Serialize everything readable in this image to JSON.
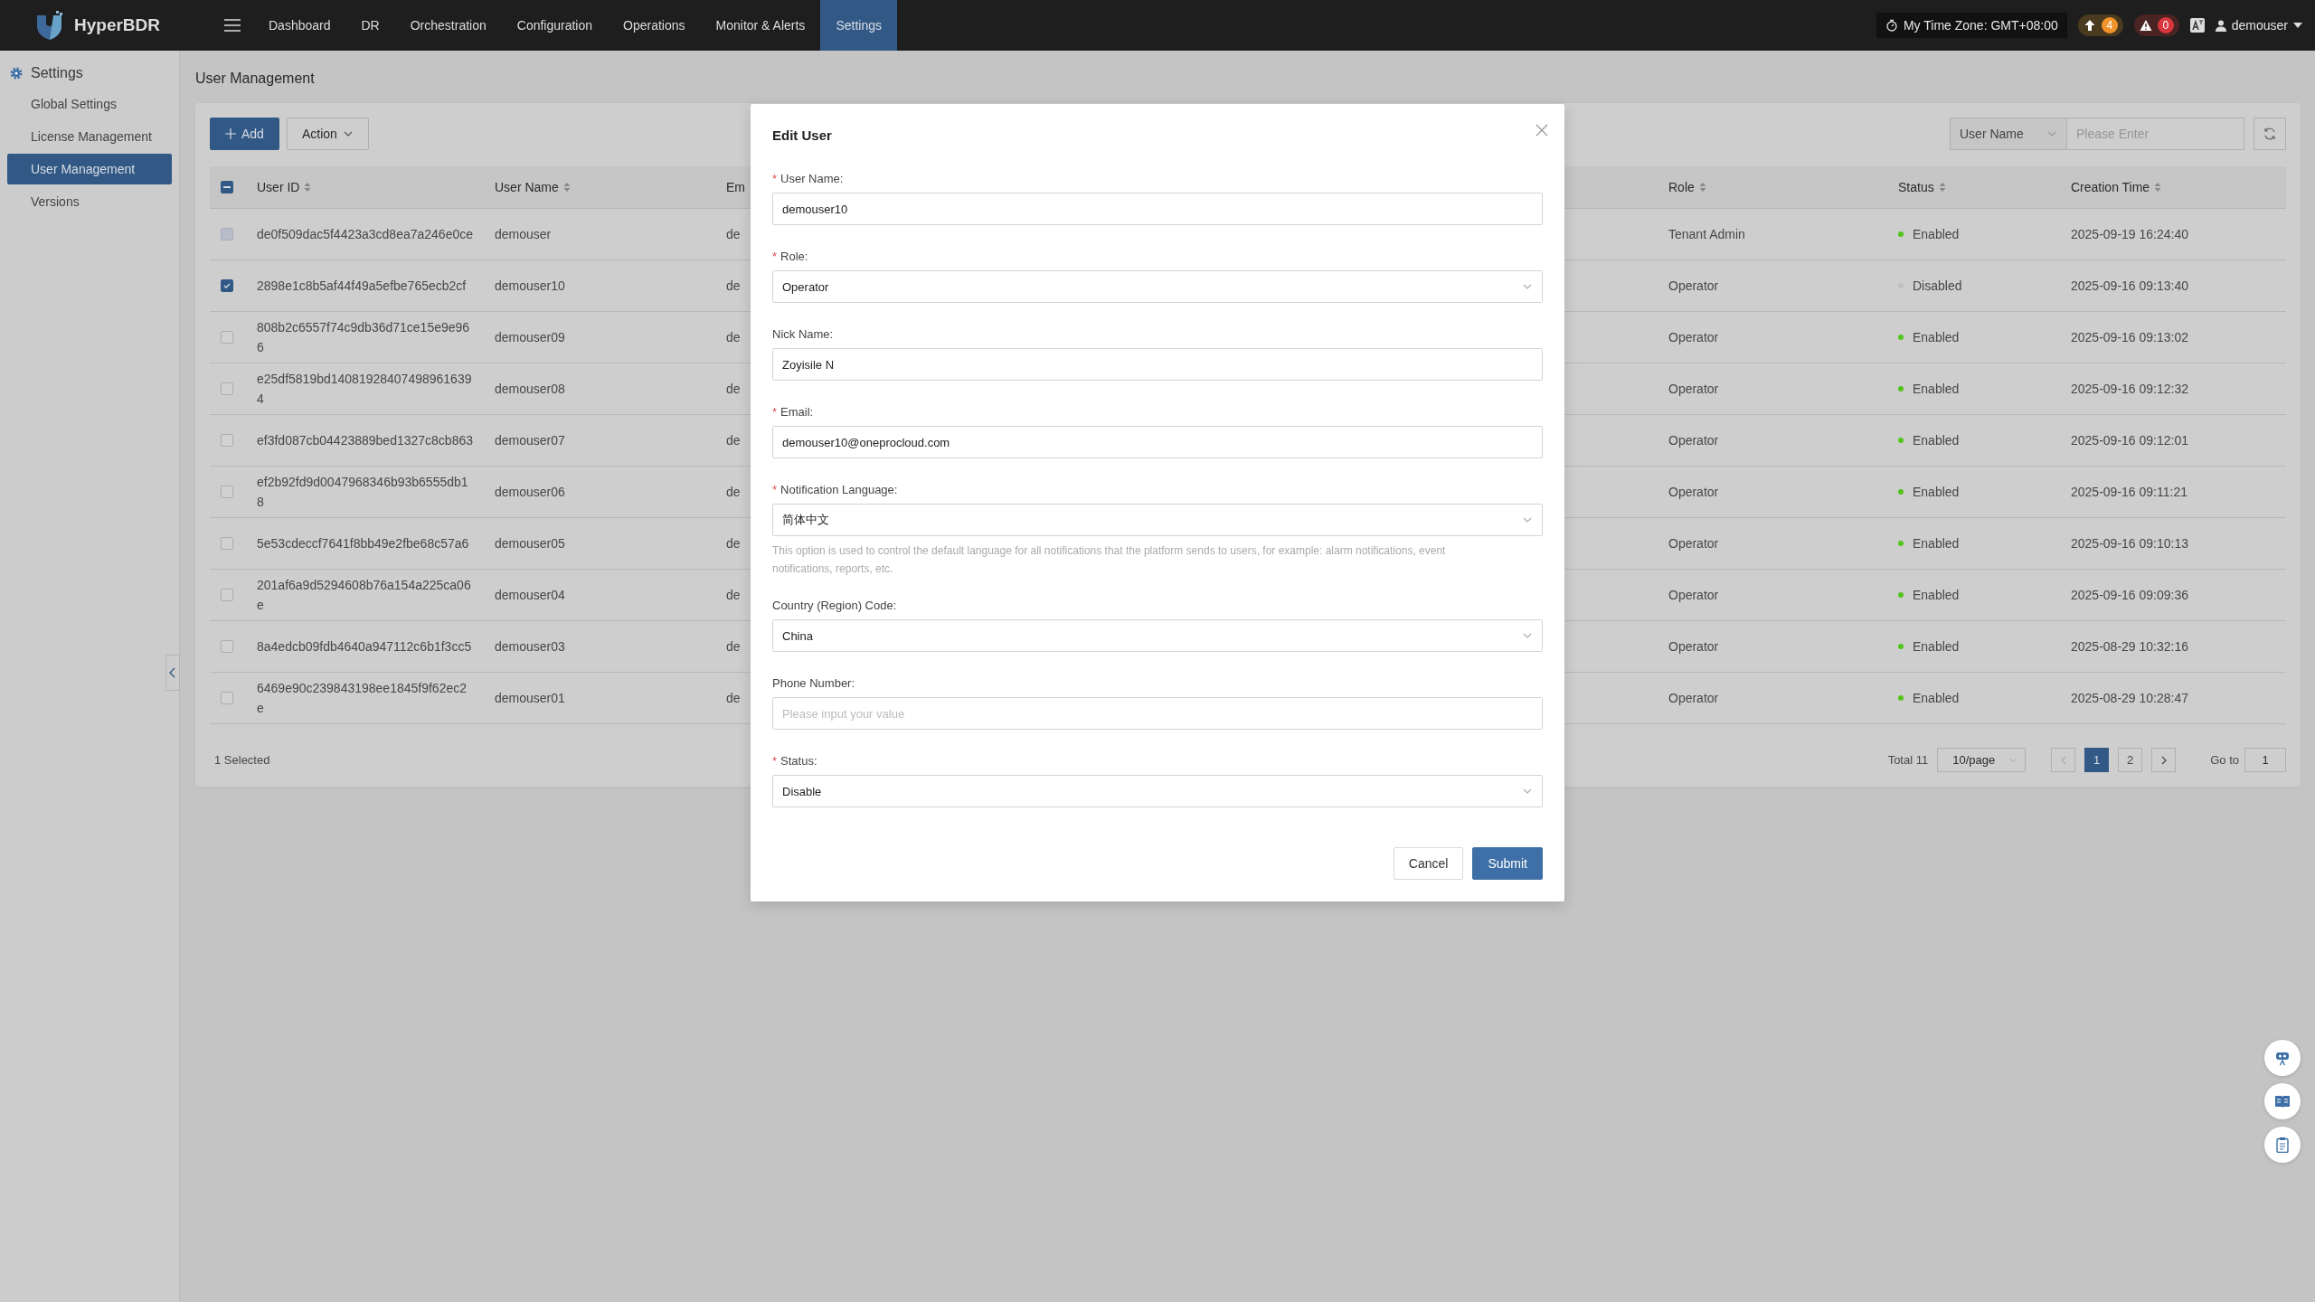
{
  "brand": "HyperBDR",
  "nav": [
    {
      "label": "Dashboard",
      "selected": false
    },
    {
      "label": "DR",
      "selected": false
    },
    {
      "label": "Orchestration",
      "selected": false
    },
    {
      "label": "Configuration",
      "selected": false
    },
    {
      "label": "Operations",
      "selected": false
    },
    {
      "label": "Monitor & Alerts",
      "selected": false
    },
    {
      "label": "Settings",
      "selected": true
    }
  ],
  "topbar": {
    "timezone": "My Time Zone: GMT+08:00",
    "upload_count": "4",
    "alert_count": "0",
    "user": "demouser"
  },
  "sidebar": {
    "title": "Settings",
    "items": [
      {
        "label": "Global Settings",
        "selected": false
      },
      {
        "label": "License Management",
        "selected": false
      },
      {
        "label": "User Management",
        "selected": true
      },
      {
        "label": "Versions",
        "selected": false
      }
    ]
  },
  "page_title": "User Management",
  "toolbar": {
    "add": "Add",
    "action": "Action",
    "search_by": "User Name",
    "search_placeholder": "Please Enter"
  },
  "table": {
    "all_indeterminate": true,
    "columns": [
      "User ID",
      "User Name",
      "Em",
      "Role",
      "Status",
      "Creation Time"
    ],
    "rows": [
      {
        "selected": false,
        "disabled": true,
        "id": "de0f509dac5f4423a3cd8ea7a246e0ce",
        "name": "demouser",
        "column_3": "de",
        "role": "Tenant Admin",
        "status": "Enabled",
        "color": "#52c41a",
        "time": "2025-09-19 16:24:40"
      },
      {
        "selected": true,
        "disabled": false,
        "id": "2898e1c8b5af44f49a5efbe765ecb2cf",
        "name": "demouser10",
        "column_3": "de",
        "role": "Operator",
        "status": "Disabled",
        "color": "#bfbfbf",
        "time": "2025-09-16 09:13:40"
      },
      {
        "selected": false,
        "disabled": false,
        "id": "808b2c6557f74c9db36d71ce15e9e966",
        "name": "demouser09",
        "column_3": "de",
        "role": "Operator",
        "status": "Enabled",
        "color": "#52c41a",
        "time": "2025-09-16 09:13:02"
      },
      {
        "selected": false,
        "disabled": false,
        "id": "e25df5819bd140819284074989616394",
        "name": "demouser08",
        "column_3": "de",
        "role": "Operator",
        "status": "Enabled",
        "color": "#52c41a",
        "time": "2025-09-16 09:12:32"
      },
      {
        "selected": false,
        "disabled": false,
        "id": "ef3fd087cb04423889bed1327c8cb863",
        "name": "demouser07",
        "column_3": "de",
        "role": "Operator",
        "status": "Enabled",
        "color": "#52c41a",
        "time": "2025-09-16 09:12:01"
      },
      {
        "selected": false,
        "disabled": false,
        "id": "ef2b92fd9d0047968346b93b6555db18",
        "name": "demouser06",
        "column_3": "de",
        "role": "Operator",
        "status": "Enabled",
        "color": "#52c41a",
        "time": "2025-09-16 09:11:21"
      },
      {
        "selected": false,
        "disabled": false,
        "id": "5e53cdeccf7641f8bb49e2fbe68c57a6",
        "name": "demouser05",
        "column_3": "de",
        "role": "Operator",
        "status": "Enabled",
        "color": "#52c41a",
        "time": "2025-09-16 09:10:13"
      },
      {
        "selected": false,
        "disabled": false,
        "id": "201af6a9d5294608b76a154a225ca06e",
        "name": "demouser04",
        "column_3": "de",
        "role": "Operator",
        "status": "Enabled",
        "color": "#52c41a",
        "time": "2025-09-16 09:09:36"
      },
      {
        "selected": false,
        "disabled": false,
        "id": "8a4edcb09fdb4640a947112c6b1f3cc5",
        "name": "demouser03",
        "column_3": "de",
        "role": "Operator",
        "status": "Enabled",
        "color": "#52c41a",
        "time": "2025-08-29 10:32:16"
      },
      {
        "selected": false,
        "disabled": false,
        "id": "6469e90c239843198ee1845f9f62ec2e",
        "name": "demouser01",
        "column_3": "de",
        "role": "Operator",
        "status": "Enabled",
        "color": "#52c41a",
        "time": "2025-08-29 10:28:47"
      }
    ]
  },
  "footer": {
    "selected_count": "1 Selected",
    "total": "Total 11",
    "page_size": "10/page",
    "pages": [
      {
        "label": "1",
        "selected": true
      },
      {
        "label": "2",
        "selected": false
      }
    ],
    "goto_label": "Go to",
    "goto_value": "1"
  },
  "modal": {
    "title": "Edit User",
    "required_mark": "*",
    "fields": [
      {
        "kind": "input",
        "label": "User Name:",
        "required": true,
        "value": "demouser10"
      },
      {
        "kind": "select",
        "label": "Role:",
        "required": true,
        "value": "Operator"
      },
      {
        "kind": "input",
        "label": "Nick Name:",
        "required": false,
        "value": "Zoyisile N"
      },
      {
        "kind": "input",
        "label": "Email:",
        "required": true,
        "value": "demouser10@oneprocloud.com"
      },
      {
        "kind": "select",
        "label": "Notification Language:",
        "required": true,
        "value": "简体中文",
        "hint": "This option is used to control the default language for all notifications that the platform sends to users, for example: alarm notifications, event notifications, reports, etc."
      },
      {
        "kind": "select",
        "label": "Country (Region) Code:",
        "required": false,
        "value": "China"
      },
      {
        "kind": "input",
        "label": "Phone Number:",
        "required": false,
        "placeholder": "Please input your value"
      },
      {
        "kind": "select",
        "label": "Status:",
        "required": true,
        "value": "Disable"
      }
    ],
    "buttons": [
      {
        "label": "Cancel",
        "kind": "default"
      },
      {
        "label": "Submit",
        "kind": "primary"
      }
    ]
  }
}
